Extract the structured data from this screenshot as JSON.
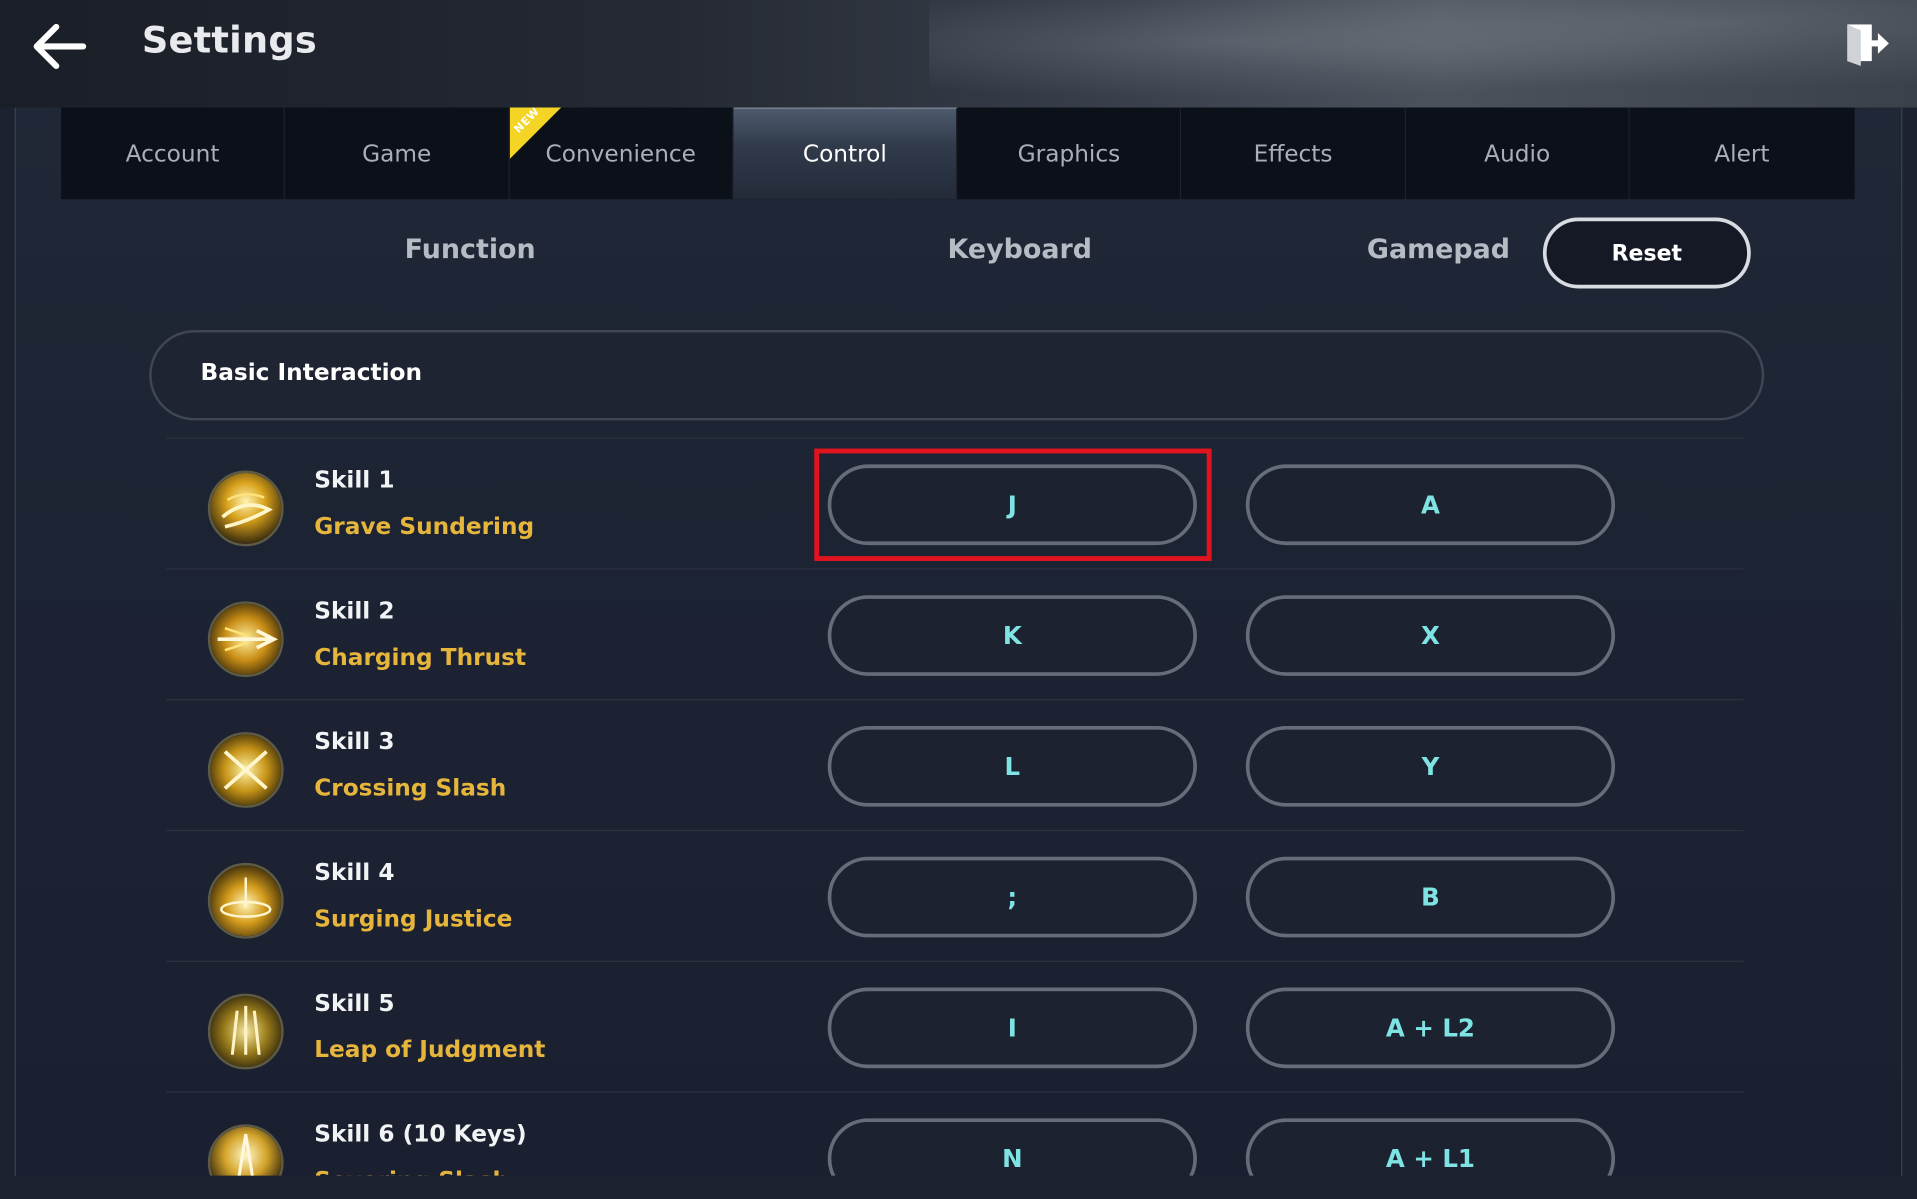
{
  "header": {
    "title": "Settings",
    "back_icon": "arrow-left-icon",
    "exit_icon": "exit-door-icon"
  },
  "tabs": [
    {
      "label": "Account",
      "active": false
    },
    {
      "label": "Game",
      "active": false
    },
    {
      "label": "Convenience",
      "active": false,
      "badge": "NEW"
    },
    {
      "label": "Control",
      "active": true
    },
    {
      "label": "Graphics",
      "active": false
    },
    {
      "label": "Effects",
      "active": false
    },
    {
      "label": "Audio",
      "active": false
    },
    {
      "label": "Alert",
      "active": false
    }
  ],
  "subtabs": {
    "function": "Function",
    "keyboard": "Keyboard",
    "gamepad": "Gamepad",
    "reset": "Reset"
  },
  "section": {
    "title": "Basic Interaction"
  },
  "skills": [
    {
      "name": "Skill 1",
      "sub": "Grave Sundering",
      "keyboard": "J",
      "gamepad": "A"
    },
    {
      "name": "Skill 2",
      "sub": "Charging Thrust",
      "keyboard": "K",
      "gamepad": "X"
    },
    {
      "name": "Skill 3",
      "sub": "Crossing Slash",
      "keyboard": "L",
      "gamepad": "Y"
    },
    {
      "name": "Skill 4",
      "sub": "Surging Justice",
      "keyboard": ";",
      "gamepad": "B"
    },
    {
      "name": "Skill 5",
      "sub": "Leap of Judgment",
      "keyboard": "I",
      "gamepad": "A + L2"
    },
    {
      "name": "Skill 6 (10 Keys)",
      "sub": "Severing Slash",
      "keyboard": "N",
      "gamepad": "A + L1"
    }
  ],
  "colors": {
    "accent_key_text": "#7fe3e4",
    "skill_sub_text": "#e6b53c",
    "new_badge": "#f4d526",
    "highlight": "#e1131e"
  }
}
